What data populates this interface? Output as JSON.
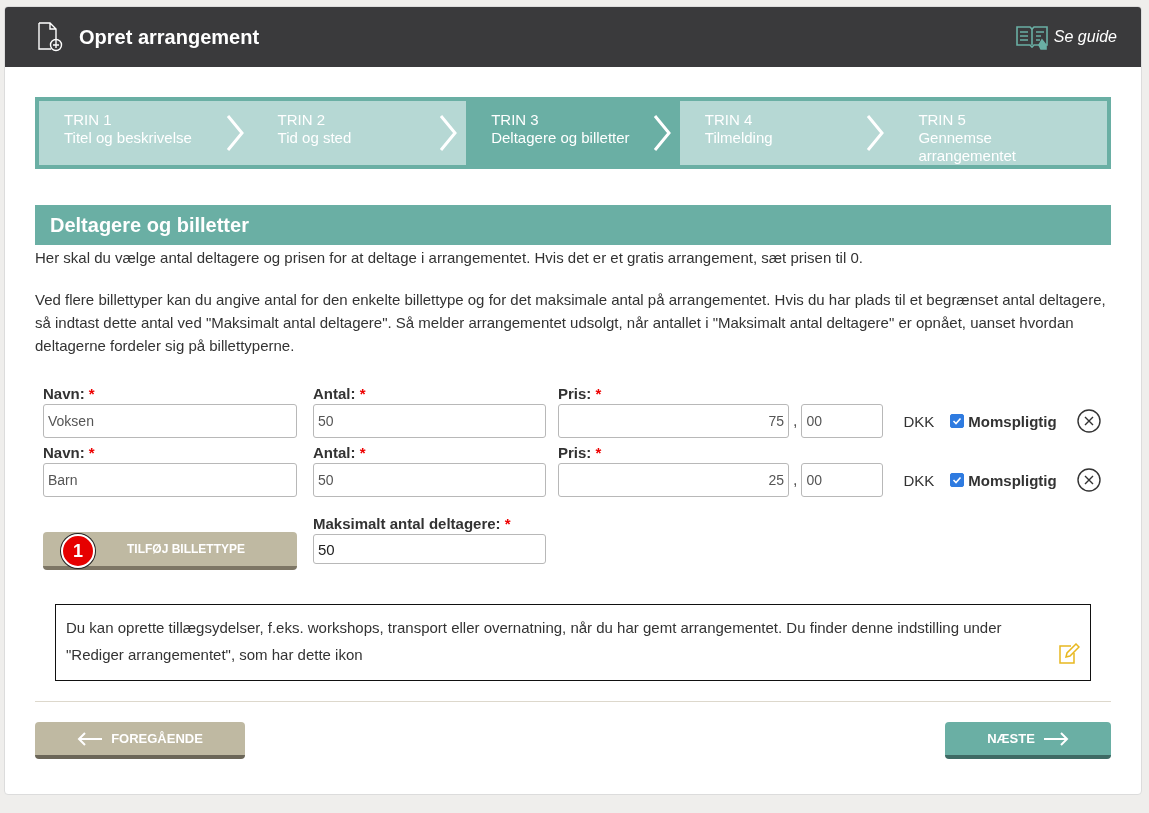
{
  "header": {
    "title": "Opret arrangement",
    "guide_link": "Se guide"
  },
  "steps": [
    {
      "number": "TRIN 1",
      "label": "Titel og beskrivelse",
      "selected": false
    },
    {
      "number": "TRIN 2",
      "label": "Tid og sted",
      "selected": false
    },
    {
      "number": "TRIN 3",
      "label": "Deltagere og billetter",
      "selected": true
    },
    {
      "number": "TRIN 4",
      "label": "Tilmelding",
      "selected": false
    },
    {
      "number": "TRIN 5",
      "label": "Gennemse arrangementet",
      "selected": false
    }
  ],
  "section": {
    "title": "Deltagere og billetter",
    "intro": "Her skal du vælge antal deltagere og prisen for at deltage i arrangementet. Hvis det er et gratis arrangement, sæt prisen til 0.",
    "details": "Ved flere billettyper kan du angive antal for den enkelte billettype og for det maksimale antal på arrangementet. Hvis du har plads til et begrænset antal deltagere, så indtast dette antal ved \"Maksimalt antal deltagere\". Så melder arrangementet udsolgt, når antallet i \"Maksimalt antal deltagere\" er opnået, uanset hvordan deltagerne fordeler sig på billettyperne."
  },
  "ticket_types": [
    {
      "name_label": "Navn:",
      "required_mark": "*",
      "name": "Voksen",
      "count_label": "Antal:",
      "count_required": "*",
      "count": "50",
      "price_label": "Pris:",
      "price_required": "*",
      "price_whole": "75",
      "separator": ",",
      "price_decimals": "00",
      "currency": "DKK",
      "vat_label": "Momspligtig",
      "checked": true
    },
    {
      "name_label": "Navn:",
      "required_mark": "*",
      "name": "Barn",
      "count_label": "Antal:",
      "count_required": "*",
      "count": "50",
      "price_label": "Pris:",
      "price_required": "*",
      "price_whole": "25",
      "separator": ",",
      "price_decimals": "00",
      "currency": "DKK",
      "vat_label": "Momspligtig",
      "checked": true
    }
  ],
  "add_button": {
    "label": "TILFØJ BILLETTYPE",
    "badge": "1"
  },
  "max_participants": {
    "label": "Maksimalt antal deltagere:",
    "required_mark": "*",
    "value": "50"
  },
  "info_box": {
    "text": "Du kan oprette tillægsydelser, f.eks. workshops, transport eller overnatning, når du har gemt arrangementet. Du finder denne indstilling under \"Rediger arrangementet\", som har dette ikon"
  },
  "footer": {
    "previous": "FOREGÅENDE",
    "next": "NÆSTE"
  }
}
